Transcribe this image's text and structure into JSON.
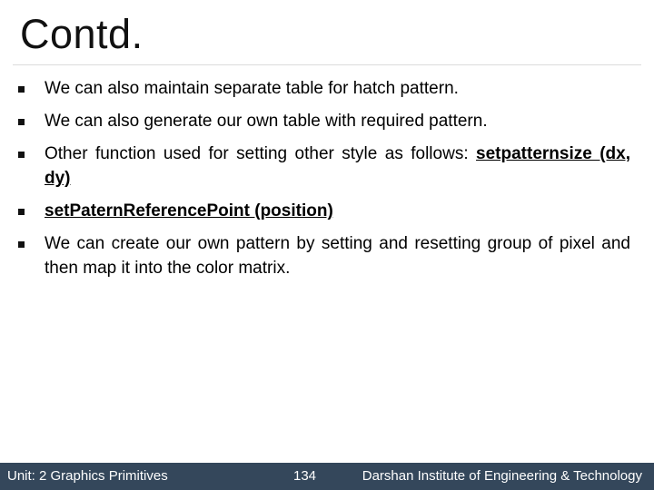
{
  "slide": {
    "title": "Contd.",
    "bullets": [
      {
        "text": "We can also maintain separate table for hatch pattern."
      },
      {
        "text": "We can also generate our own table with required pattern."
      },
      {
        "text": "Other function used for setting other style as follows:",
        "code": "setpatternsize (dx, dy)"
      },
      {
        "code": "setPaternReferencePoint (position)"
      },
      {
        "text": "We can create our own pattern by setting and resetting group of pixel and then map it into the color matrix."
      }
    ]
  },
  "footer": {
    "unit": "Unit: 2 Graphics Primitives",
    "page_number": "134",
    "institute": "Darshan Institute of Engineering & Technology",
    "background_color": "#34475b"
  }
}
